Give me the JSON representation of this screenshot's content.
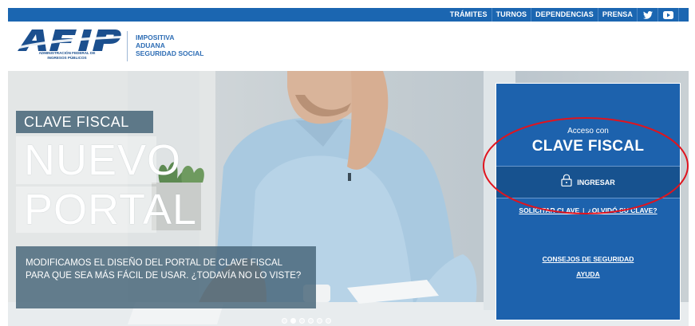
{
  "topnav": {
    "links": [
      "TRÁMITES",
      "TURNOS",
      "DEPENDENCIAS",
      "PRENSA"
    ],
    "icons": [
      "twitter-icon",
      "youtube-icon"
    ]
  },
  "header": {
    "logo_caption_line1": "ADMINISTRACIÓN FEDERAL DE",
    "logo_caption_line2": "INGRESOS PÚBLICOS",
    "tagline": [
      "IMPOSITIVA",
      "ADUANA",
      "SEGURIDAD SOCIAL"
    ]
  },
  "hero": {
    "kicker": "CLAVE FISCAL",
    "headline_line1": "NUEVO",
    "headline_line2": "PORTAL",
    "message_line1": "MODIFICAMOS EL DISEÑO DEL PORTAL DE CLAVE FISCAL",
    "message_line2": "PARA QUE SEA MÁS FÁCIL DE USAR. ¿TODAVÍA NO LO VISTE?",
    "slide_count": 6,
    "active_slide": 1
  },
  "login_panel": {
    "acceso_label": "Acceso con",
    "title": "CLAVE FISCAL",
    "ingresar_label": "INGRESAR",
    "solicitar_label": "SOLICITAR CLAVE",
    "olvido_label": "¿OLVIDÓ SU CLAVE?",
    "seguridad_label": "CONSEJOS DE SEGURIDAD",
    "ayuda_label": "AYUDA"
  },
  "colors": {
    "brand_blue": "#1b66b1",
    "panel_blue": "#1d62ad",
    "annotation_red": "#e0141e"
  }
}
